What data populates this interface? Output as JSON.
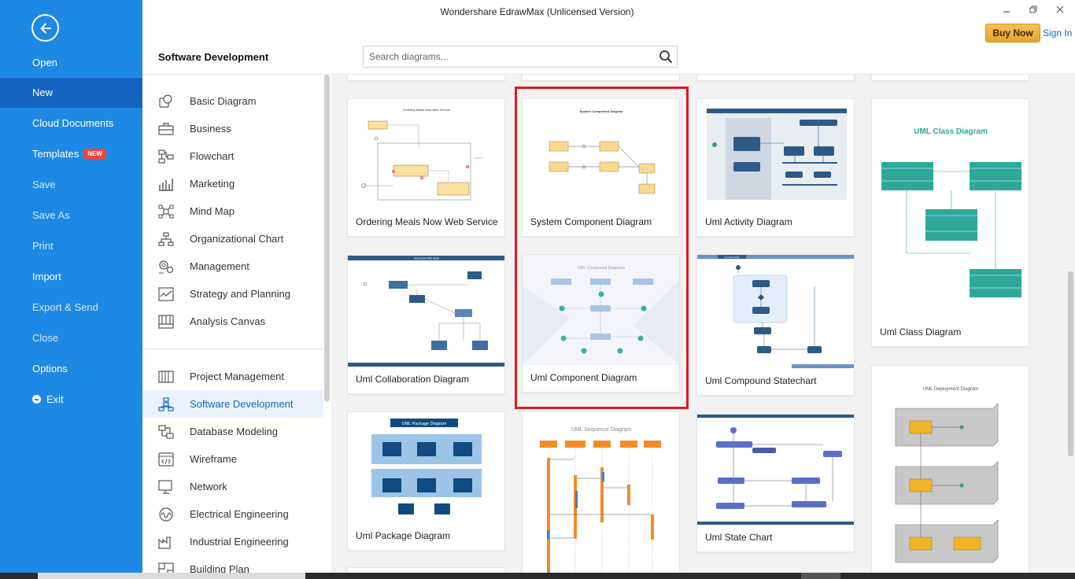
{
  "window": {
    "title": "Wondershare EdrawMax (Unlicensed Version)",
    "buy_now": "Buy Now",
    "sign_in": "Sign In"
  },
  "nav": {
    "items": [
      {
        "label": "Open"
      },
      {
        "label": "New"
      },
      {
        "label": "Cloud Documents"
      },
      {
        "label": "Templates",
        "badge": "NEW"
      },
      {
        "label": "Save"
      },
      {
        "label": "Save As"
      },
      {
        "label": "Print"
      },
      {
        "label": "Import"
      },
      {
        "label": "Export & Send"
      },
      {
        "label": "Close"
      },
      {
        "label": "Options"
      },
      {
        "label": "Exit"
      }
    ]
  },
  "header": {
    "section_title": "Software Development",
    "search_placeholder": "Search diagrams..."
  },
  "categories": {
    "items": [
      {
        "label": "Basic Diagram",
        "icon": "basic-diagram-icon"
      },
      {
        "label": "Business",
        "icon": "briefcase-icon"
      },
      {
        "label": "Flowchart",
        "icon": "flowchart-icon"
      },
      {
        "label": "Marketing",
        "icon": "bar-chart-icon"
      },
      {
        "label": "Mind Map",
        "icon": "mind-map-icon"
      },
      {
        "label": "Organizational Chart",
        "icon": "org-chart-icon"
      },
      {
        "label": "Management",
        "icon": "management-icon"
      },
      {
        "label": "Strategy and Planning",
        "icon": "strategy-icon"
      },
      {
        "label": "Analysis Canvas",
        "icon": "canvas-icon"
      },
      {
        "label": "Project Management",
        "icon": "gantt-icon"
      },
      {
        "label": "Software Development",
        "icon": "software-icon"
      },
      {
        "label": "Database Modeling",
        "icon": "database-icon"
      },
      {
        "label": "Wireframe",
        "icon": "code-window-icon"
      },
      {
        "label": "Network",
        "icon": "monitor-icon"
      },
      {
        "label": "Electrical Engineering",
        "icon": "waveform-icon"
      },
      {
        "label": "Industrial Engineering",
        "icon": "factory-icon"
      },
      {
        "label": "Building Plan",
        "icon": "floor-plan-icon"
      }
    ]
  },
  "templates": [
    {
      "label": "Ordering Meals Now Web Service",
      "thumb_title": "Ordering Meals Now Web Service"
    },
    {
      "label": "System Component Diagram",
      "thumb_title": "System Component Diagram"
    },
    {
      "label": "Uml Activity Diagram"
    },
    {
      "label": "Uml Class Diagram",
      "thumb_title": "UML Class Diagram"
    },
    {
      "label": "Uml Collaboration Diagram",
      "thumb_title": "Insert your title here!"
    },
    {
      "label": "Uml Component Diagram",
      "thumb_title": "UML Component Diagrams"
    },
    {
      "label": "Uml Compound Statechart",
      "thumb_title": "Company/Title"
    },
    {
      "label": "Uml Deployment Diagram",
      "thumb_title": "UML Deployment Diagram"
    },
    {
      "label": "Uml Package Diagram",
      "thumb_title": "UML Package Diagram"
    },
    {
      "label": "Uml Sequence Diagram",
      "thumb_title": "UML Sequence Diagram"
    },
    {
      "label": "Uml State Chart"
    }
  ],
  "colors": {
    "nav_bg": "#1e88e5",
    "nav_active": "#1565c0",
    "accent": "#1565c0",
    "selection": "#e0191e",
    "buy_now": "#f0b040"
  }
}
